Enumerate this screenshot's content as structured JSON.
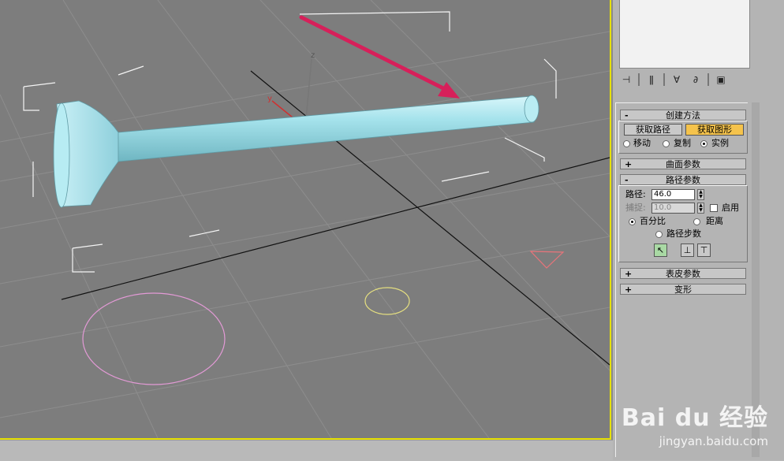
{
  "panel": {
    "rollouts": {
      "create_method": {
        "title": "创建方法",
        "toggle": "-",
        "get_path_label": "获取路径",
        "get_shape_label": "获取图形",
        "move_label": "移动",
        "copy_label": "复制",
        "instance_label": "实例",
        "selected_option": "实例"
      },
      "surface_params": {
        "title": "曲面参数",
        "toggle": "+"
      },
      "path_params": {
        "title": "路径参数",
        "toggle": "-",
        "path_label": "路径:",
        "path_value": "46.0",
        "snap_label": "捕捉:",
        "snap_value": "10.0",
        "enable_label": "启用",
        "percent_label": "百分比",
        "distance_label": "距离",
        "path_steps_label": "路径步数",
        "selected_option": "百分比"
      },
      "skin_params": {
        "title": "表皮参数",
        "toggle": "+"
      },
      "deformation": {
        "title": "变形",
        "toggle": "+"
      }
    }
  },
  "viewport": {
    "axis_labels": {
      "x": "x",
      "y": "y",
      "z": "z"
    },
    "colors": {
      "background": "#7d7d7d",
      "border_active": "#e6e000",
      "object": "#9fe0ea",
      "arrow": "#d6205a",
      "circle_large": "#e39ad6",
      "circle_small": "#e6e080",
      "triangle": "#e8747a"
    }
  },
  "watermark": {
    "brand": "Bai du 经验",
    "url": "jingyan.baidu.com"
  }
}
